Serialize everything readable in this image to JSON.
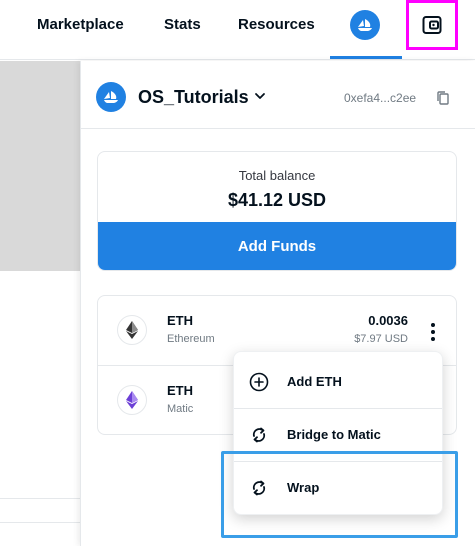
{
  "nav": {
    "links": [
      "Marketplace",
      "Stats",
      "Resources"
    ]
  },
  "account": {
    "name": "OS_Tutorials",
    "address": "0xefa4...c2ee"
  },
  "balance": {
    "label": "Total balance",
    "value": "$41.12 USD",
    "add_funds_label": "Add Funds"
  },
  "tokens": [
    {
      "symbol": "ETH",
      "network": "Ethereum",
      "amount": "0.0036",
      "usd": "$7.97 USD",
      "icon": "ethereum-icon"
    },
    {
      "symbol": "ETH",
      "network": "Matic",
      "amount": "",
      "usd": "",
      "icon": "ethereum-purple-icon"
    }
  ],
  "menu": {
    "items": [
      {
        "label": "Add ETH",
        "icon": "plus-circle-icon"
      },
      {
        "label": "Bridge to Matic",
        "icon": "refresh-icon"
      },
      {
        "label": "Wrap",
        "icon": "refresh-icon"
      }
    ]
  },
  "colors": {
    "accent": "#2081e2",
    "highlight_magenta": "#ff00ff",
    "highlight_blue": "#3a9ee8"
  }
}
